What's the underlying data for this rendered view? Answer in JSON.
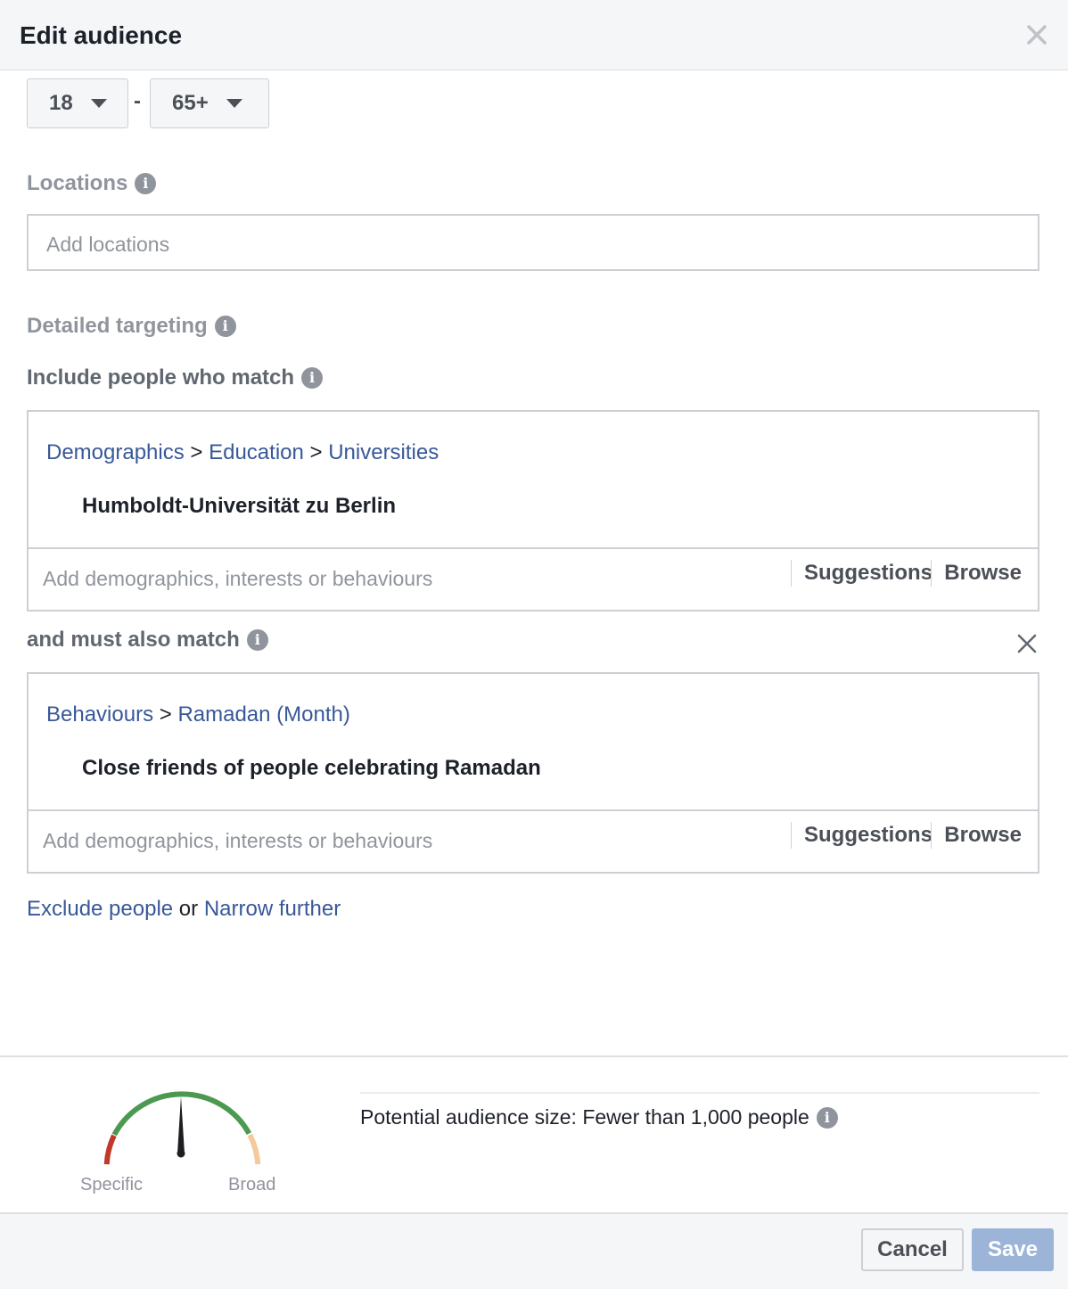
{
  "dialog": {
    "title": "Edit audience"
  },
  "age": {
    "min": "18",
    "separator": "-",
    "max": "65+"
  },
  "locations": {
    "label": "Locations",
    "placeholder": "Add locations"
  },
  "detailed": {
    "label": "Detailed targeting",
    "include_label": "Include people who match",
    "include": {
      "crumbs": [
        "Demographics",
        "Education",
        "Universities"
      ],
      "crumb_sep": ">",
      "item": "Humboldt-Universität zu Berlin",
      "placeholder": "Add demographics, interests or behaviours",
      "suggestions": "Suggestions",
      "browse": "Browse"
    },
    "also_label": "and must also match",
    "also": {
      "crumbs": [
        "Behaviours",
        "Ramadan (Month)"
      ],
      "crumb_sep": ">",
      "item": "Close friends of people celebrating Ramadan",
      "placeholder": "Add demographics, interests or behaviours",
      "suggestions": "Suggestions",
      "browse": "Browse"
    }
  },
  "links": {
    "exclude": "Exclude people",
    "or": "or",
    "narrow": "Narrow further"
  },
  "audience": {
    "gauge_specific": "Specific",
    "gauge_broad": "Broad",
    "gauge_level": 0.5,
    "size_text": "Potential audience size: Fewer than 1,000 people"
  },
  "footer": {
    "cancel": "Cancel",
    "save": "Save"
  },
  "icons": {
    "info": "info-icon",
    "close": "close-icon",
    "caret": "caret-down-icon"
  },
  "colors": {
    "link": "#385898",
    "save_disabled": "#9cb4d8",
    "gauge_red": "#c0392b",
    "gauge_green": "#4c9a52",
    "gauge_peach": "#f4c99b"
  }
}
